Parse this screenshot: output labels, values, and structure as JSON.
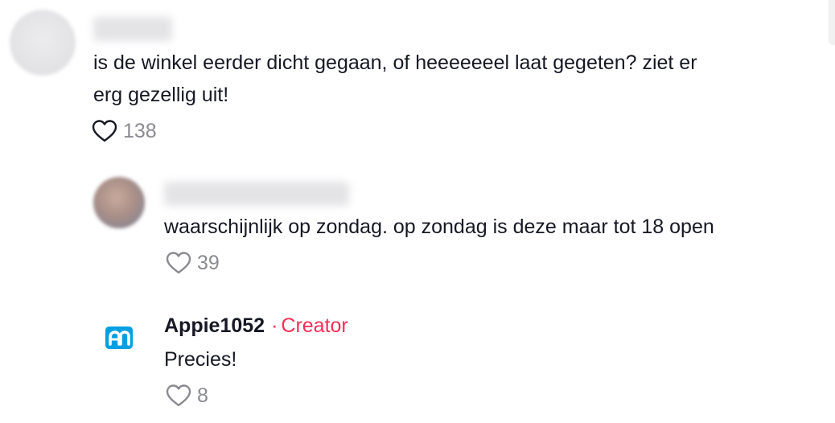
{
  "comments": [
    {
      "text_line1": "is de winkel eerder dicht gegaan, of heeeeeeel laat gegeten? ziet er",
      "text_line2": "erg gezellig uit!",
      "likes": "138"
    },
    {
      "text": "waarschijnlijk op zondag. op zondag is deze maar tot 18 open",
      "likes": "39"
    },
    {
      "username": "Appie1052",
      "separator": "·",
      "creator_label": "Creator",
      "text": "Precies!",
      "likes": "8",
      "avatar_logo": "ah"
    }
  ],
  "colors": {
    "text": "#161823",
    "muted": "#8a8b91",
    "creator": "#fe2c55",
    "ah_blue": "#00a0e2"
  }
}
